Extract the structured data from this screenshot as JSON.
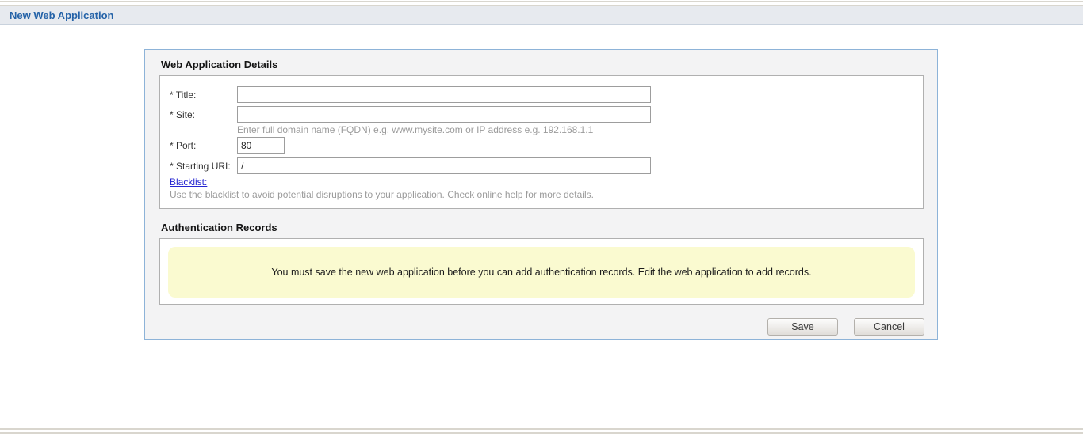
{
  "header": {
    "title": "New Web Application"
  },
  "details": {
    "heading": "Web Application Details",
    "title_field": {
      "label": "* Title:",
      "value": ""
    },
    "site_field": {
      "label": "* Site:",
      "value": "",
      "hint": "Enter full domain name (FQDN) e.g. www.mysite.com or IP address e.g. 192.168.1.1"
    },
    "port_field": {
      "label": "* Port:",
      "value": "80"
    },
    "uri_field": {
      "label": "* Starting URI:",
      "value": "/"
    },
    "blacklist": {
      "link_label": "Blacklist:",
      "hint": "Use the blacklist to avoid potential disruptions to your application. Check online help for more details."
    }
  },
  "authentication": {
    "heading": "Authentication Records",
    "notice": "You must save the new web application before you can add authentication records. Edit the web application to add records."
  },
  "actions": {
    "save_label": "Save",
    "cancel_label": "Cancel"
  },
  "colors": {
    "header_text": "#2563a8",
    "panel_border": "#8db3d8",
    "panel_background": "#f3f3f4",
    "notice_background": "#fafad0",
    "link_blue": "#2626d2",
    "hint_gray": "#9b9b9b"
  }
}
